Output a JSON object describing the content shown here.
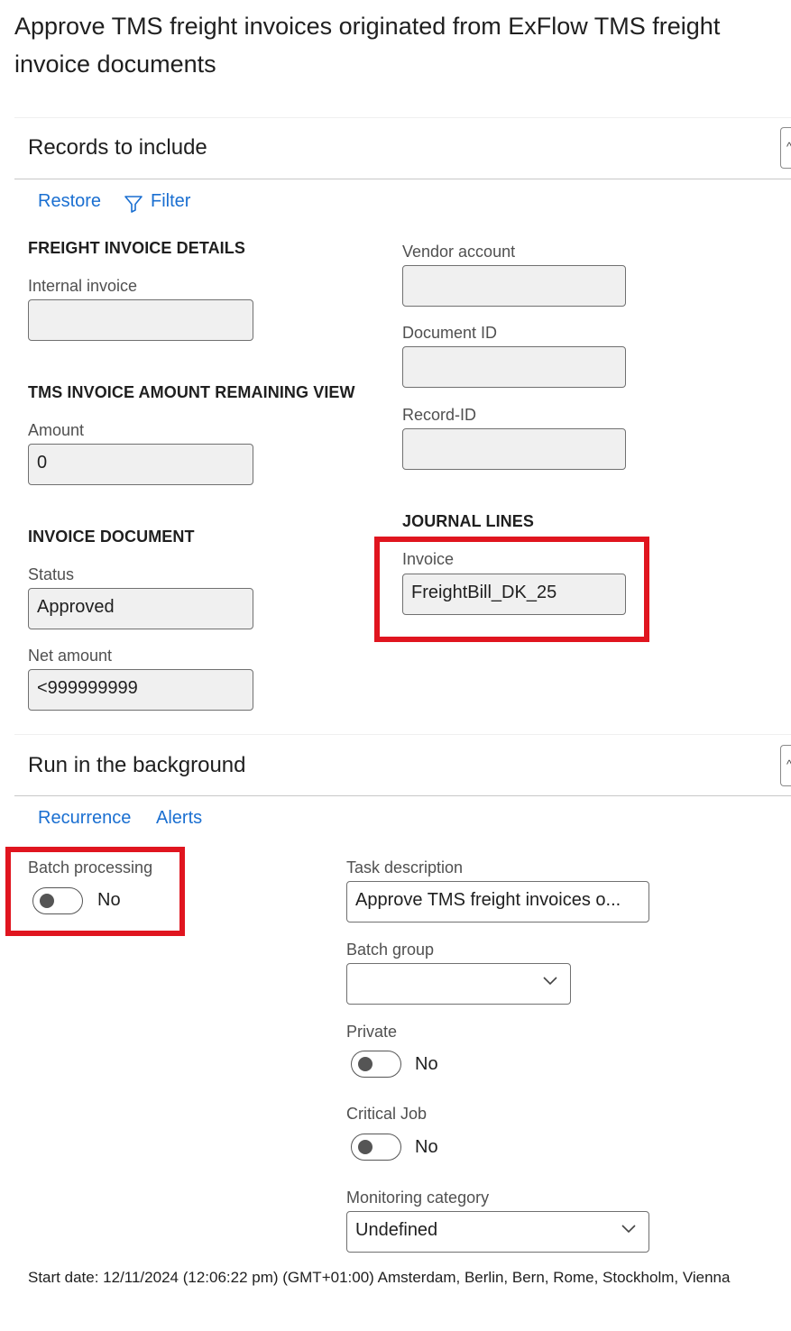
{
  "page": {
    "title": "Approve TMS freight invoices originated from ExFlow TMS freight invoice documents"
  },
  "records_section": {
    "title": "Records to include",
    "collapse_glyph": "^",
    "actions": {
      "restore_label": "Restore",
      "filter_label": "Filter"
    },
    "freight_invoice_details": {
      "title": "FREIGHT INVOICE DETAILS",
      "internal_invoice_label": "Internal invoice",
      "internal_invoice_value": ""
    },
    "tms_invoice_amount_remaining_view": {
      "title": "TMS INVOICE AMOUNT REMAINING VIEW",
      "amount_label": "Amount",
      "amount_value": "0"
    },
    "invoice_document": {
      "title": "INVOICE DOCUMENT",
      "status_label": "Status",
      "status_value": "Approved",
      "net_amount_label": "Net amount",
      "net_amount_value": "<999999999"
    },
    "vendor_account": {
      "label": "Vendor account",
      "value": ""
    },
    "document_id": {
      "label": "Document ID",
      "value": ""
    },
    "record_id": {
      "label": "Record-ID",
      "value": ""
    },
    "journal_lines": {
      "title": "JOURNAL LINES",
      "invoice_label": "Invoice",
      "invoice_value": "FreightBill_DK_25"
    }
  },
  "background_section": {
    "title": "Run in the background",
    "collapse_glyph": "^",
    "actions": {
      "recurrence_label": "Recurrence",
      "alerts_label": "Alerts"
    },
    "batch_processing": {
      "label": "Batch processing",
      "value": "No"
    },
    "task_description": {
      "label": "Task description",
      "value": "Approve TMS freight invoices o..."
    },
    "batch_group": {
      "label": "Batch group",
      "value": ""
    },
    "private": {
      "label": "Private",
      "value": "No"
    },
    "critical_job": {
      "label": "Critical Job",
      "value": "No"
    },
    "monitoring_category": {
      "label": "Monitoring category",
      "value": "Undefined"
    },
    "start_date_text": "Start date: 12/11/2024 (12:06:22 pm) (GMT+01:00) Amsterdam, Berlin, Bern, Rome, Stockholm, Vienna"
  },
  "icons": {
    "filter": "filter-icon",
    "chevron": "chevron-down-icon",
    "collapse": "chevron-up-icon"
  },
  "colors": {
    "link": "#1a6fd1",
    "highlight": "#e0151f",
    "field_background": "#f0f0f0"
  }
}
